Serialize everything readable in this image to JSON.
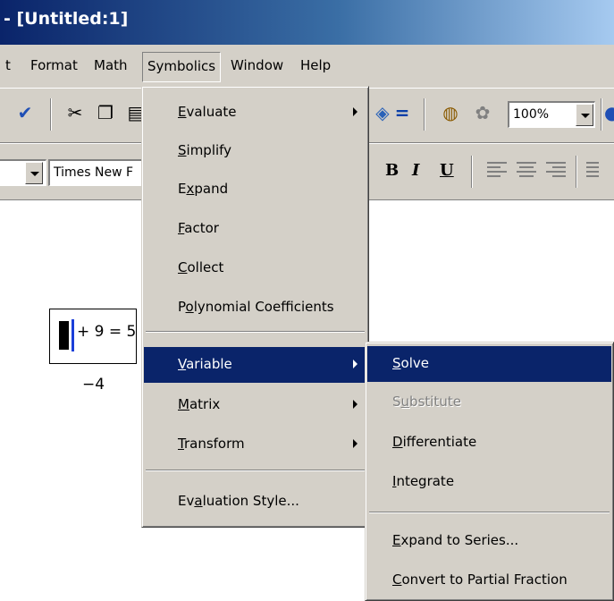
{
  "window": {
    "title": "- [Untitled:1]"
  },
  "menubar": {
    "items": [
      "t",
      "Format",
      "Math",
      "Symbolics",
      "Window",
      "Help"
    ]
  },
  "toolbar": {
    "zoom": "100%"
  },
  "formatbar": {
    "font": "Times New F",
    "bold": "B",
    "italic": "I",
    "underline": "U"
  },
  "worksheet": {
    "equation": {
      "expr": "+ 9 = 5"
    },
    "result": "−4"
  },
  "symbolics_menu": {
    "items": [
      {
        "pre": "",
        "key": "E",
        "post": "valuate",
        "submenu": true
      },
      {
        "pre": "",
        "key": "S",
        "post": "implify",
        "submenu": false
      },
      {
        "pre": "E",
        "key": "x",
        "post": "pand",
        "submenu": false
      },
      {
        "pre": "",
        "key": "F",
        "post": "actor",
        "submenu": false
      },
      {
        "pre": "",
        "key": "C",
        "post": "ollect",
        "submenu": false
      },
      {
        "pre": "P",
        "key": "o",
        "post": "lynomial Coefficients",
        "submenu": false
      },
      {
        "pre": "",
        "key": "V",
        "post": "ariable",
        "submenu": true
      },
      {
        "pre": "",
        "key": "M",
        "post": "atrix",
        "submenu": true
      },
      {
        "pre": "",
        "key": "T",
        "post": "ransform",
        "submenu": true
      },
      {
        "pre": "Ev",
        "key": "a",
        "post": "luation Style...",
        "submenu": false
      }
    ]
  },
  "variable_submenu": {
    "items": [
      {
        "pre": "",
        "key": "S",
        "post": "olve"
      },
      {
        "pre": "S",
        "key": "u",
        "post": "bstitute"
      },
      {
        "pre": "",
        "key": "D",
        "post": "ifferentiate"
      },
      {
        "pre": "",
        "key": "I",
        "post": "ntegrate"
      },
      {
        "pre": "",
        "key": "E",
        "post": "xpand to Series..."
      },
      {
        "pre": "",
        "key": "C",
        "post": "onvert to Partial Fraction"
      }
    ]
  },
  "colors": {
    "titlebar": "#0a246a",
    "menu_face": "#d4d0c8",
    "highlight": "#0a246a",
    "cursor_bar": "#1b3fd9"
  }
}
